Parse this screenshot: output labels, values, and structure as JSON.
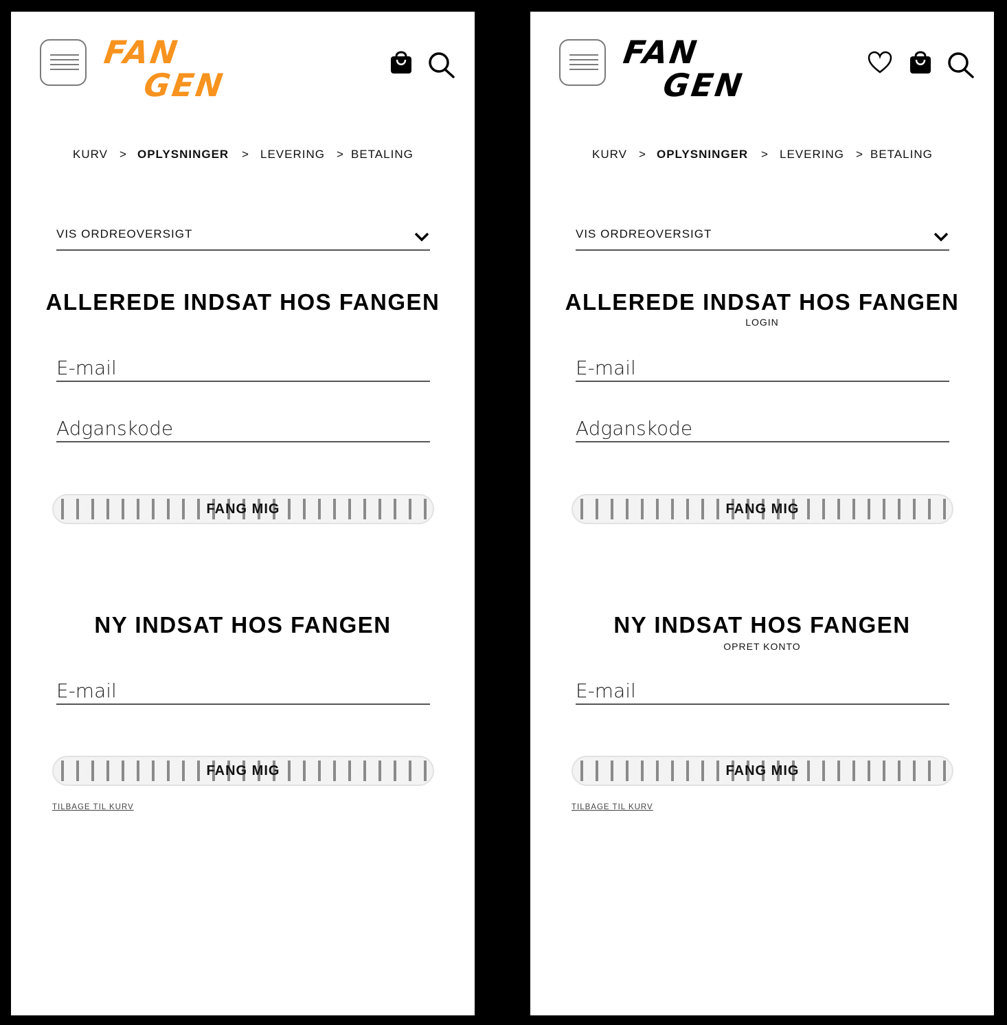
{
  "brand": {
    "logo_line1": "FAN",
    "logo_line2": "GEN",
    "accent_color": "#F7931E",
    "dark_color": "#000000"
  },
  "icons": {
    "menu": "hamburger-menu-icon",
    "heart": "heart-icon",
    "bag": "shopping-bag-icon",
    "search": "search-icon",
    "chevron": "chevron-down-icon"
  },
  "breadcrumb": {
    "step1": "KURV",
    "sep1": ">",
    "step2": "OPLYSNINGER",
    "sep2": ">",
    "step3": "LEVERING",
    "sep3": ">",
    "step4": "BETALING",
    "active_step": "OPLYSNINGER"
  },
  "order_summary": {
    "label": "VIS ORDREOVERSIGT"
  },
  "login": {
    "heading": "ALLEREDE INDSAT HOS FANGEN",
    "subheading": "LOGIN",
    "email_placeholder": "E-mail",
    "password_placeholder": "Adganskode",
    "button_label": "FANG MIG"
  },
  "signup": {
    "heading": "NY INDSAT HOS FANGEN",
    "subheading": "OPRET KONTO",
    "email_placeholder": "E-mail",
    "button_label": "FANG MIG"
  },
  "back_link": "TILBAGE TIL KURV"
}
